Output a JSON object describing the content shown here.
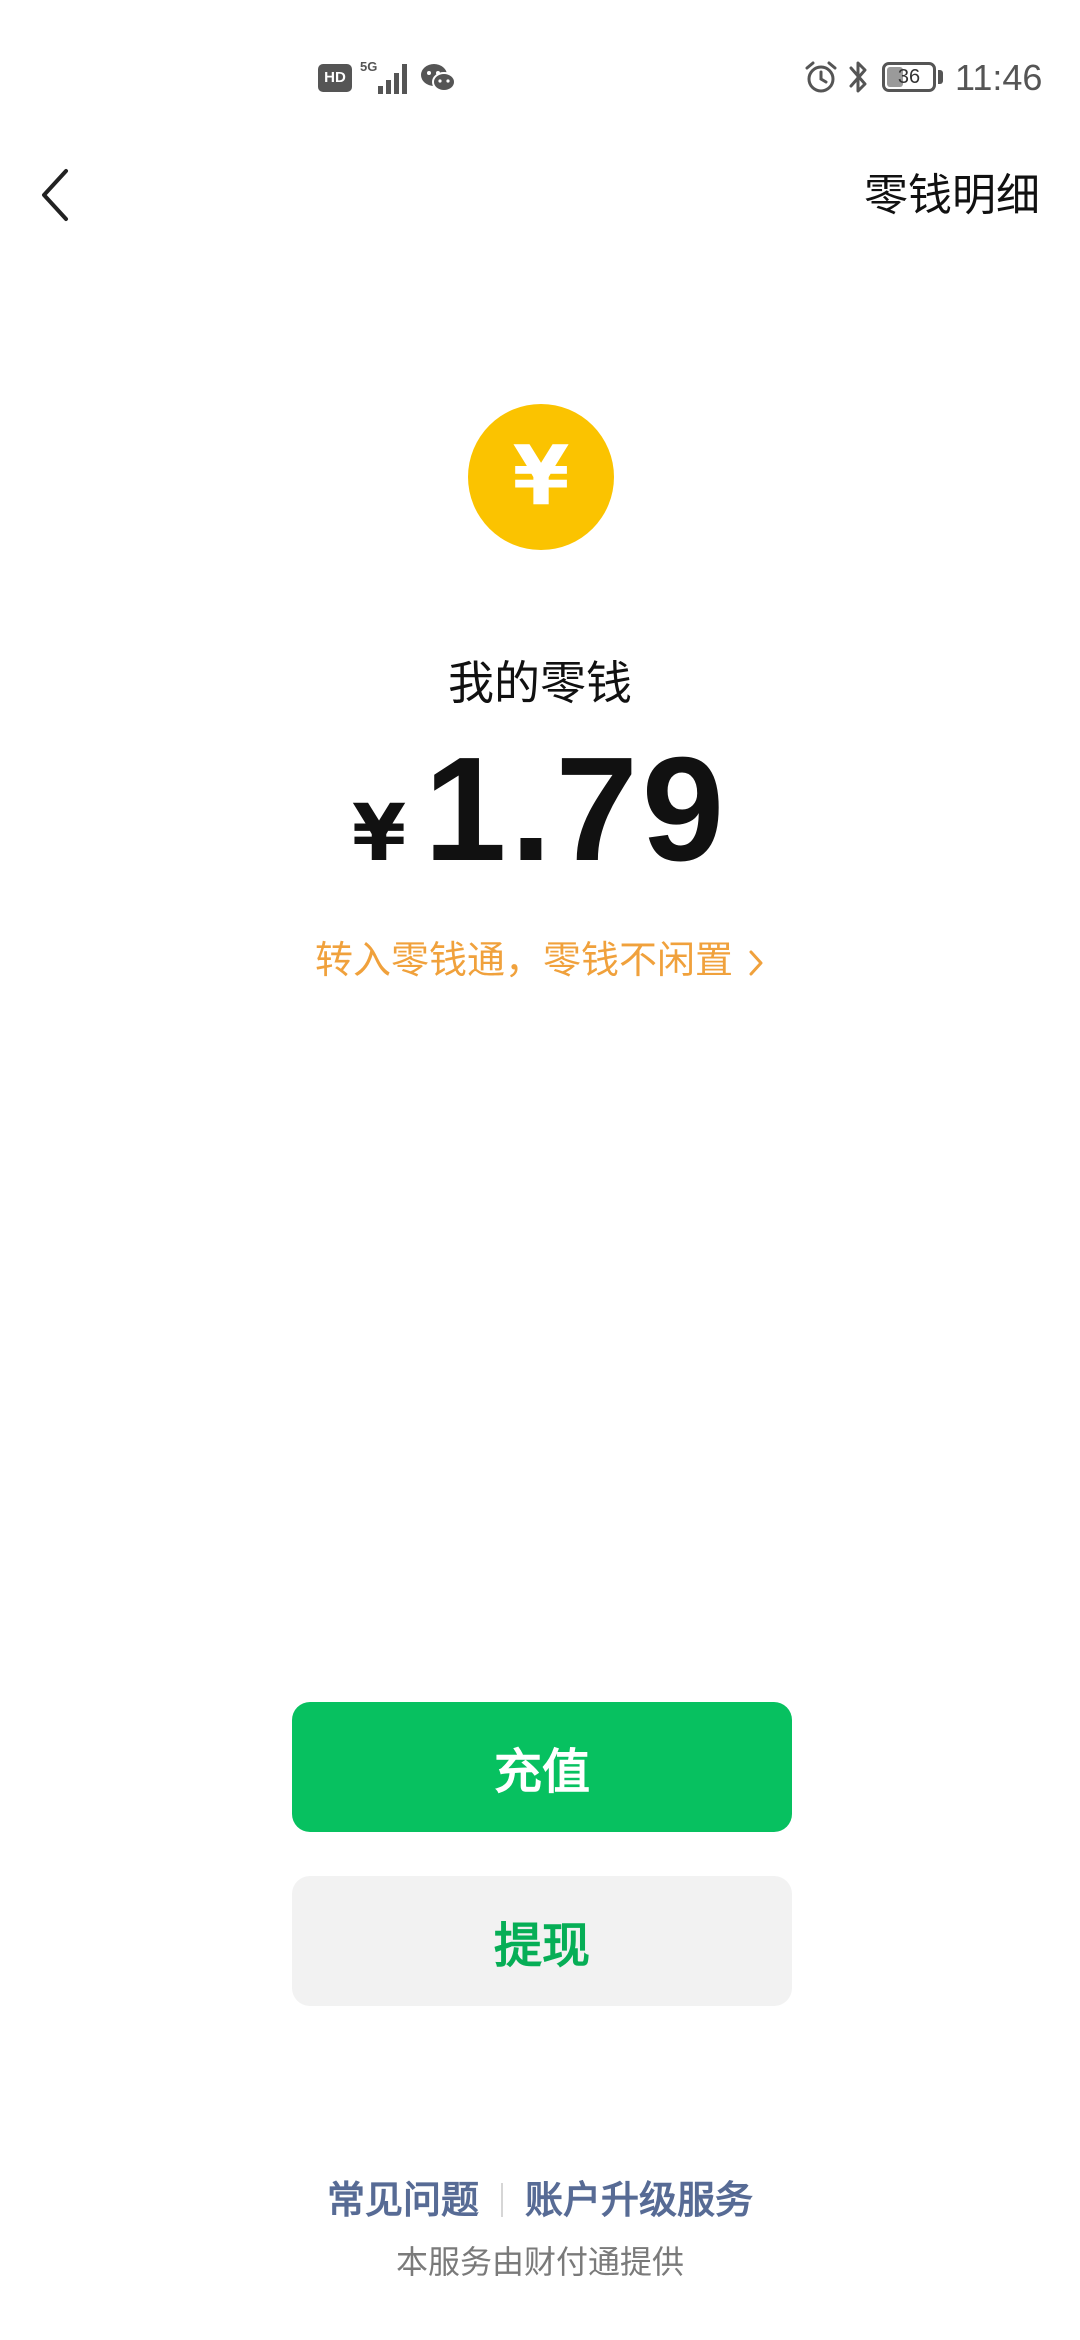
{
  "status_bar": {
    "hd_badge": "HD",
    "network": "5G",
    "battery": "36",
    "battery_level": 0.36,
    "time": "11:46",
    "icons": [
      "hd-icon",
      "signal-icon",
      "wechat-icon",
      "alarm-icon",
      "bluetooth-icon",
      "battery-icon"
    ]
  },
  "nav": {
    "back_icon": "chevron-left-icon",
    "right_link": "零钱明细"
  },
  "wallet": {
    "coin_symbol": "¥",
    "label": "我的零钱",
    "currency": "¥",
    "amount": "1.79",
    "promo": "转入零钱通，零钱不闲置"
  },
  "actions": {
    "recharge_label": "充值",
    "withdraw_label": "提现"
  },
  "footer": {
    "faq": "常见问题",
    "upgrade": "账户升级服务",
    "provider": "本服务由财付通提供"
  },
  "colors": {
    "coin": "#fbc300",
    "primary_green": "#07c160",
    "promo_orange": "#f0a13c",
    "link_blue": "#576b95"
  }
}
